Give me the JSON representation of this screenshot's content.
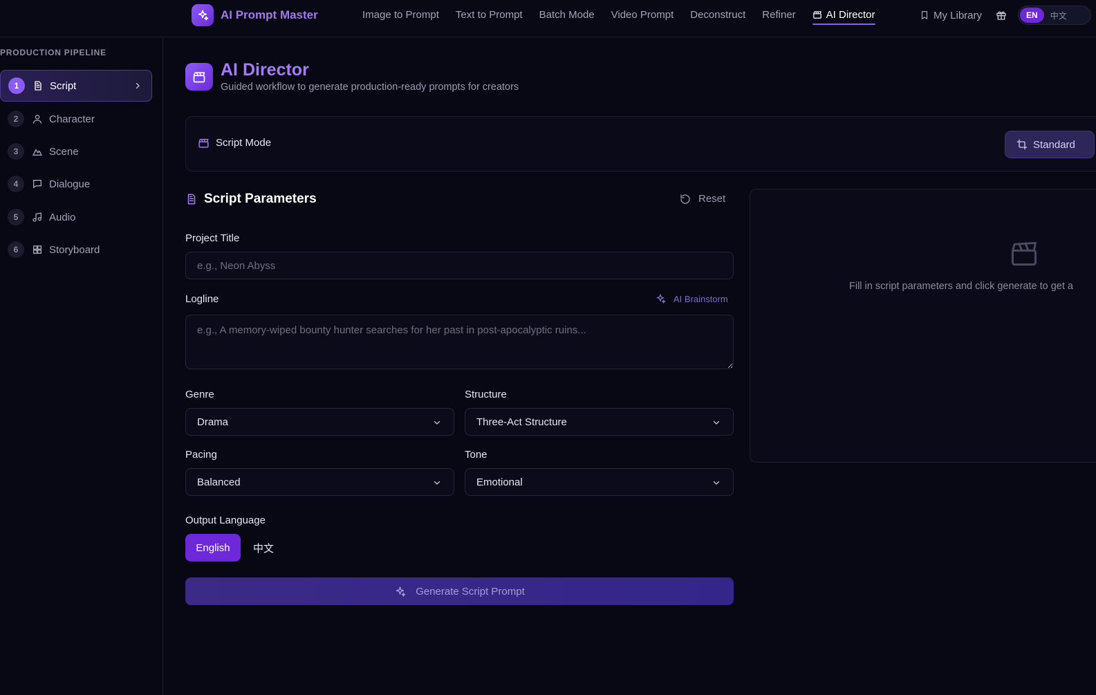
{
  "app": {
    "name": "AI Prompt Master"
  },
  "nav": {
    "items": [
      {
        "label": "Image to Prompt"
      },
      {
        "label": "Text to Prompt"
      },
      {
        "label": "Batch Mode"
      },
      {
        "label": "Video Prompt"
      },
      {
        "label": "Deconstruct"
      },
      {
        "label": "Refiner"
      },
      {
        "label": "AI Director",
        "active": true
      }
    ],
    "library_label": "My Library",
    "lang": {
      "en": "EN",
      "zh": "中文",
      "selected": "EN"
    }
  },
  "sidebar": {
    "title": "PRODUCTION PIPELINE",
    "steps": [
      {
        "num": "1",
        "label": "Script",
        "icon": "document-icon",
        "active": true
      },
      {
        "num": "2",
        "label": "Character",
        "icon": "user-icon"
      },
      {
        "num": "3",
        "label": "Scene",
        "icon": "mountain-icon"
      },
      {
        "num": "4",
        "label": "Dialogue",
        "icon": "speech-bubble-icon"
      },
      {
        "num": "5",
        "label": "Audio",
        "icon": "music-note-icon"
      },
      {
        "num": "6",
        "label": "Storyboard",
        "icon": "grid-icon"
      }
    ]
  },
  "page": {
    "title": "AI Director",
    "subtitle": "Guided workflow to generate production-ready prompts for creators"
  },
  "mode": {
    "label": "Script Mode",
    "standard_label": "Standard"
  },
  "form": {
    "section_title": "Script Parameters",
    "reset_label": "Reset",
    "project_title": {
      "label": "Project Title",
      "placeholder": "e.g., Neon Abyss",
      "value": ""
    },
    "logline": {
      "label": "Logline",
      "placeholder": "e.g., A memory-wiped bounty hunter searches for her past in post-apocalyptic ruins...",
      "value": "",
      "brainstorm_label": "AI Brainstorm"
    },
    "genre": {
      "label": "Genre",
      "value": "Drama"
    },
    "structure": {
      "label": "Structure",
      "value": "Three-Act Structure"
    },
    "pacing": {
      "label": "Pacing",
      "value": "Balanced"
    },
    "tone": {
      "label": "Tone",
      "value": "Emotional"
    },
    "output_language": {
      "label": "Output Language",
      "options": [
        "English",
        "中文"
      ],
      "selected": "English"
    },
    "generate_label": "Generate Script Prompt"
  },
  "preview": {
    "empty_text": "Fill in script parameters and click generate to get a"
  },
  "colors": {
    "accent": "#8b5cf6",
    "accent_dark": "#6d28d9",
    "background": "#080814"
  }
}
